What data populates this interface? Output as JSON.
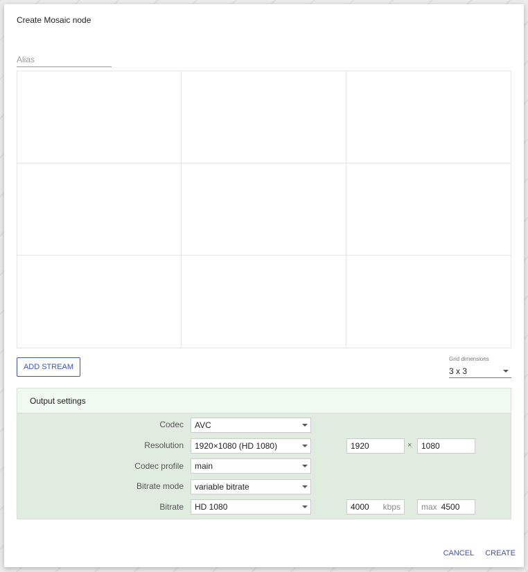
{
  "dialog": {
    "title": "Create Mosaic node",
    "alias_placeholder": "Alias",
    "add_stream_label": "ADD STREAM",
    "grid_dimensions": {
      "label": "Grid dimensions",
      "value": "3 x 3"
    },
    "grid": {
      "rows": 3,
      "cols": 3
    },
    "output": {
      "header": "Output settings",
      "codec": {
        "label": "Codec",
        "value": "AVC"
      },
      "resolution": {
        "label": "Resolution",
        "value": "1920×1080 (HD 1080)",
        "width": "1920",
        "height": "1080",
        "separator": "×"
      },
      "codec_profile": {
        "label": "Codec profile",
        "value": "main"
      },
      "bitrate_mode": {
        "label": "Bitrate mode",
        "value": "variable bitrate"
      },
      "bitrate": {
        "label": "Bitrate",
        "value": "HD 1080",
        "kbps_value": "4000",
        "kbps_unit": "kbps",
        "max_prefix": "max",
        "max_value": "4500"
      }
    },
    "actions": {
      "cancel": "CANCEL",
      "create": "CREATE"
    }
  },
  "colors": {
    "accent": "#3f51b5",
    "output_bg": "#e1ece1",
    "output_header_bg": "#f1faf1"
  },
  "icons": {
    "dropdown": "chevron-down-icon"
  }
}
